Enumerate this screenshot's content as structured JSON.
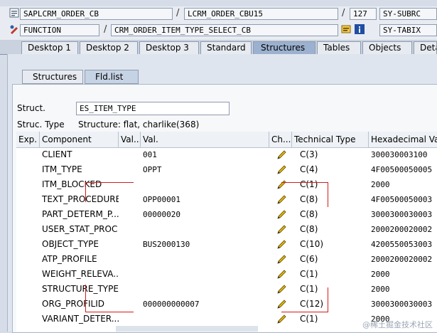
{
  "toolbar": {
    "program": "SAPLCRM_ORDER_CB",
    "include": "LCRM_ORDER_CBU15",
    "line": "127",
    "var1": "SY-SUBRC",
    "event_type": "FUNCTION",
    "event_name": "CRM_ORDER_ITEM_TYPE_SELECT_CB",
    "var2": "SY-TABIX",
    "sep": "/"
  },
  "tabs": [
    "Desktop 1",
    "Desktop 2",
    "Desktop 3",
    "Standard",
    "Structures",
    "Tables",
    "Objects",
    "Deta"
  ],
  "subtabs": [
    "Structures",
    "Fld.list"
  ],
  "struct": {
    "label": "Struct.",
    "value": "ES_ITEM_TYPE",
    "type_label": "Struc. Type",
    "type_value": "Structure: flat, charlike(368)"
  },
  "grid": {
    "headers": [
      "Exp.",
      "Component",
      "Val...",
      "Val.",
      "Ch...",
      "Technical Type",
      "Hexadecimal Valu"
    ],
    "rows": [
      {
        "comp": "CLIENT",
        "val": "001",
        "type": "C(3)",
        "hex": "300030003100"
      },
      {
        "comp": "ITM_TYPE",
        "val": "OPPT",
        "type": "C(4)",
        "hex": "4F00500050005"
      },
      {
        "comp": "ITM_BLOCKED",
        "val": "",
        "type": "C(1)",
        "hex": "2000"
      },
      {
        "comp": "TEXT_PROCEDURE",
        "val": "OPP00001",
        "type": "C(8)",
        "hex": "4F00500050003"
      },
      {
        "comp": "PART_DETERM_P...",
        "val": "00000020",
        "type": "C(8)",
        "hex": "3000300030003"
      },
      {
        "comp": "USER_STAT_PROC",
        "val": "",
        "type": "C(8)",
        "hex": "2000200020002"
      },
      {
        "comp": "OBJECT_TYPE",
        "val": "BUS2000130",
        "type": "C(10)",
        "hex": "4200550053003"
      },
      {
        "comp": "ATP_PROFILE",
        "val": "",
        "type": "C(6)",
        "hex": "2000200020002"
      },
      {
        "comp": "WEIGHT_RELEVA...",
        "val": "",
        "type": "C(1)",
        "hex": "2000"
      },
      {
        "comp": "STRUCTURE_TYPE",
        "val": "",
        "type": "C(1)",
        "hex": "2000"
      },
      {
        "comp": "ORG_PROFILID",
        "val": "000000000007",
        "type": "C(12)",
        "hex": "3000300030003"
      },
      {
        "comp": "VARIANT_DETER...",
        "val": "",
        "type": "C(1)",
        "hex": "2000"
      }
    ]
  },
  "watermark": "@稀土掘金技术社区",
  "colors": {
    "accent": "#9cb1cf",
    "annotation": "#d21c1c",
    "pencil": "#e6b800"
  }
}
